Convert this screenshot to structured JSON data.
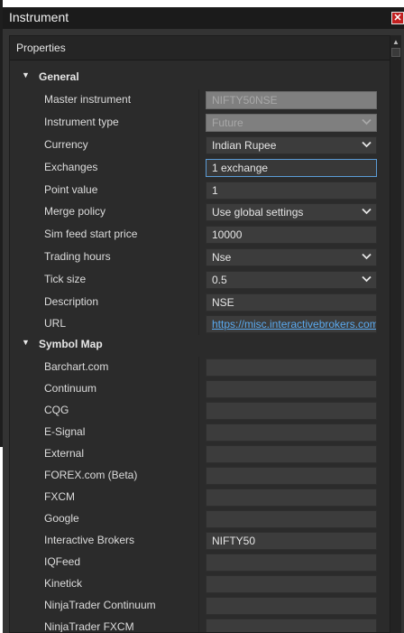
{
  "window": {
    "title": "Instrument"
  },
  "panel": {
    "header": "Properties"
  },
  "general": {
    "label": "General",
    "rows": [
      {
        "name": "Master instrument",
        "value": "NIFTY50NSE",
        "state": "disabled",
        "dropdown": false
      },
      {
        "name": "Instrument type",
        "value": "Future",
        "state": "disabled",
        "dropdown": true
      },
      {
        "name": "Currency",
        "value": "Indian Rupee",
        "state": "normal",
        "dropdown": true
      },
      {
        "name": "Exchanges",
        "value": "1 exchange",
        "state": "focused",
        "dropdown": false
      },
      {
        "name": "Point value",
        "value": "1",
        "state": "normal",
        "dropdown": false
      },
      {
        "name": "Merge policy",
        "value": "Use global settings",
        "state": "normal",
        "dropdown": true
      },
      {
        "name": "Sim feed start price",
        "value": "10000",
        "state": "normal",
        "dropdown": false
      },
      {
        "name": "Trading hours",
        "value": "Nse",
        "state": "normal",
        "dropdown": true
      },
      {
        "name": "Tick size",
        "value": "0.5",
        "state": "normal",
        "dropdown": true
      },
      {
        "name": "Description",
        "value": "NSE",
        "state": "normal",
        "dropdown": false
      },
      {
        "name": "URL",
        "value": "https://misc.interactivebrokers.com",
        "state": "link",
        "dropdown": false
      }
    ]
  },
  "symbol_map": {
    "label": "Symbol Map",
    "rows": [
      {
        "name": "Barchart.com",
        "value": ""
      },
      {
        "name": "Continuum",
        "value": ""
      },
      {
        "name": "CQG",
        "value": ""
      },
      {
        "name": "E-Signal",
        "value": ""
      },
      {
        "name": "External",
        "value": ""
      },
      {
        "name": "FOREX.com (Beta)",
        "value": ""
      },
      {
        "name": "FXCM",
        "value": ""
      },
      {
        "name": "Google",
        "value": ""
      },
      {
        "name": "Interactive Brokers",
        "value": "NIFTY50"
      },
      {
        "name": "IQFeed",
        "value": ""
      },
      {
        "name": "Kinetick",
        "value": ""
      },
      {
        "name": "NinjaTrader Continuum",
        "value": ""
      },
      {
        "name": "NinjaTrader FXCM",
        "value": ""
      }
    ]
  },
  "icons": {
    "close": "close-icon",
    "expand": "chevron-down-icon",
    "dropdown": "chevron-down-icon"
  }
}
